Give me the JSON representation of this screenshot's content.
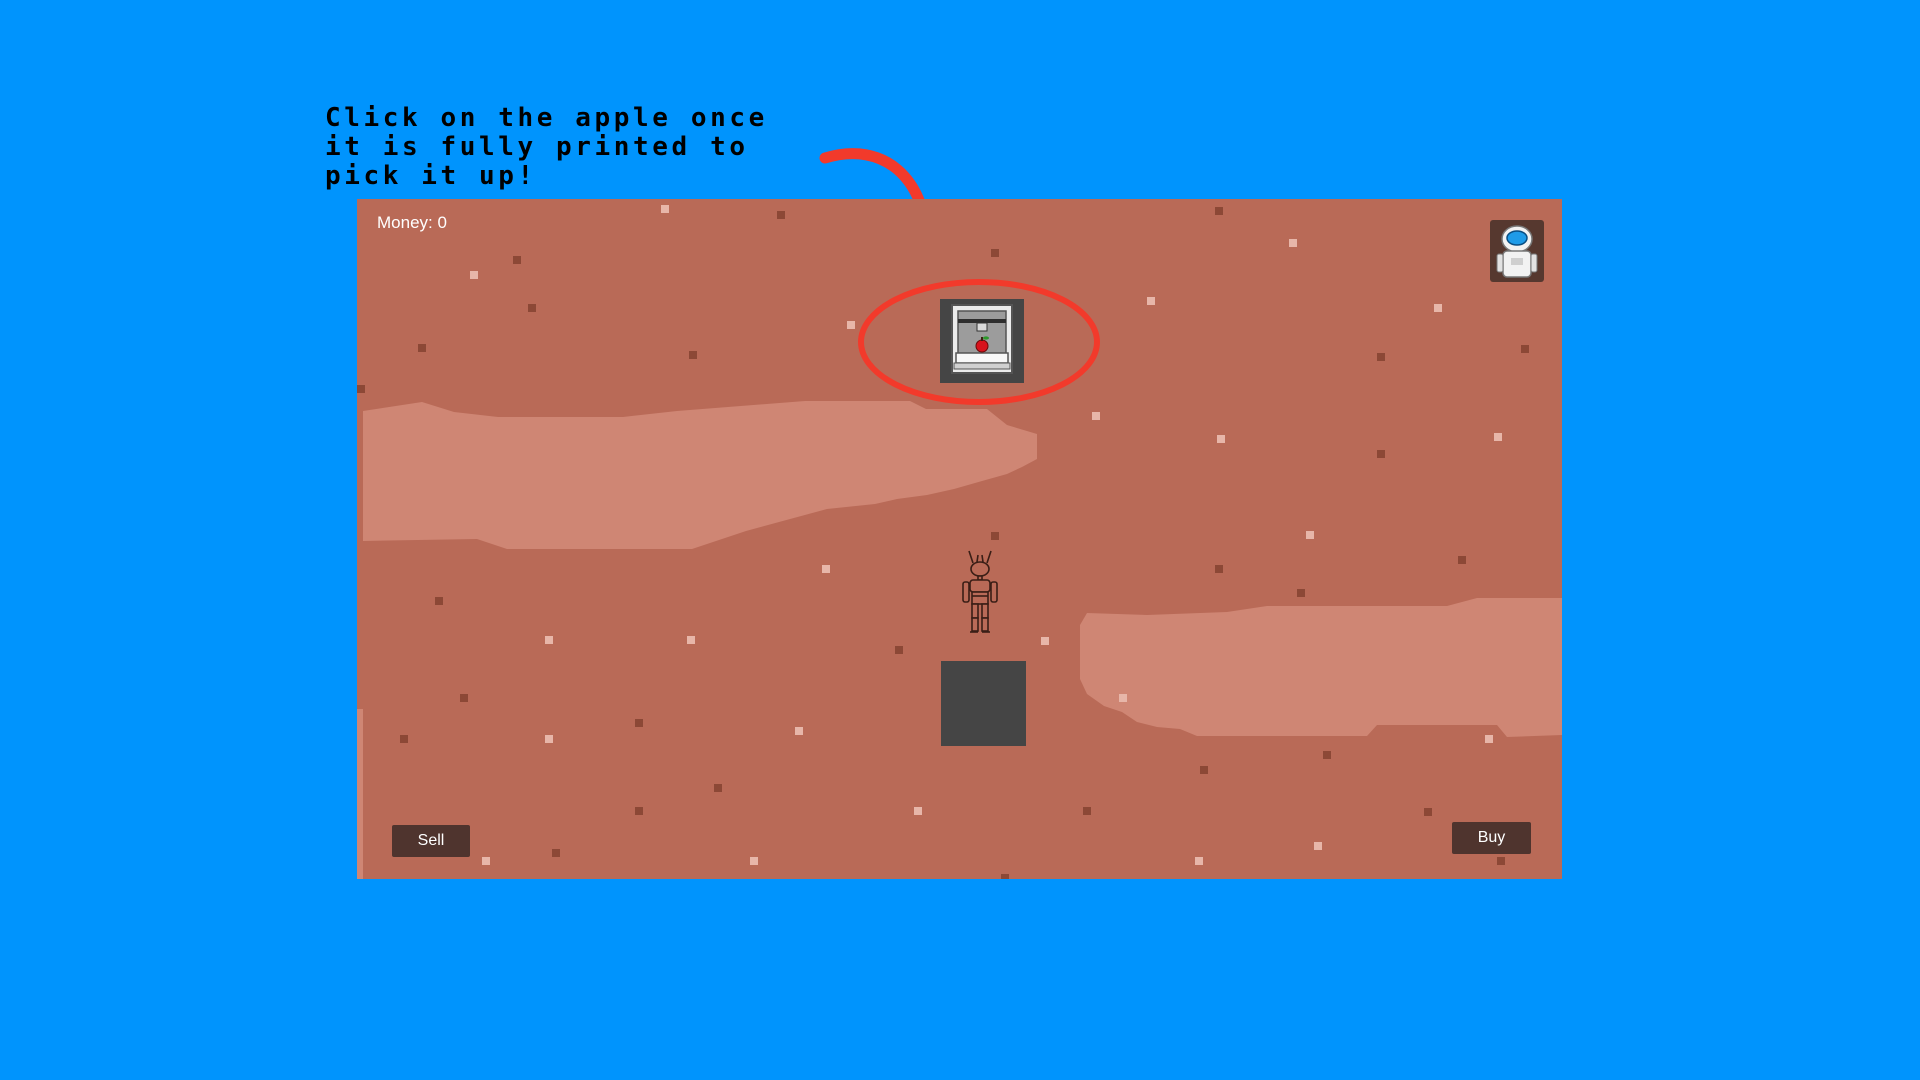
{
  "tutorial": {
    "hint_text": "Click on the apple once\nit is fully printed to\npick it up!"
  },
  "hud": {
    "money_label": "Money: 0"
  },
  "buttons": {
    "sell_label": "Sell",
    "buy_label": "Buy"
  },
  "icons": {
    "avatar": "astronaut-icon",
    "printer": "3d-printer-icon",
    "printed_item": "apple-icon",
    "player": "robot-icon",
    "arrow": "arrow-icon"
  },
  "colors": {
    "sky": "#0094FD",
    "ground": "#B96A57",
    "ground_light": "#CF8674",
    "highlight_ring": "#F23A2B",
    "button": "#4F342E",
    "slot": "#454545"
  }
}
